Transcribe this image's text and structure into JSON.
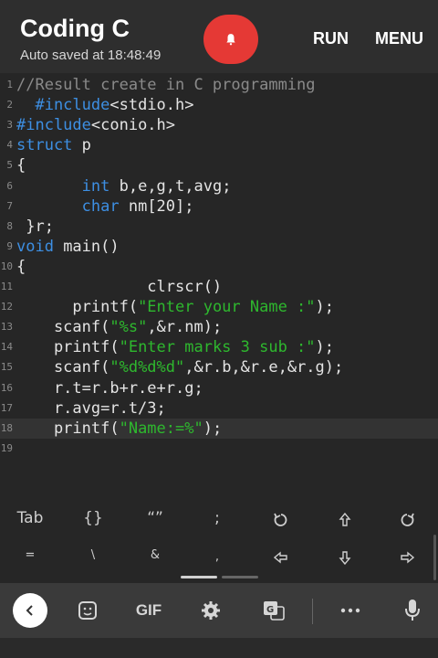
{
  "header": {
    "title": "Coding C",
    "subtitle": "Auto saved at 18:48:49",
    "run_label": "RUN",
    "menu_label": "MENU",
    "notification_icon": "bell-icon",
    "accent": "#e53935"
  },
  "editor": {
    "lines": [
      {
        "num": "1",
        "tokens": [
          {
            "t": "//Result create in C programming",
            "c": "comment"
          }
        ]
      },
      {
        "num": "2",
        "tokens": [
          {
            "t": "  #include",
            "c": "kw"
          },
          {
            "t": "<stdio.h>",
            "c": "plain"
          }
        ]
      },
      {
        "num": "3",
        "tokens": [
          {
            "t": "#include",
            "c": "kw"
          },
          {
            "t": "<conio.h>",
            "c": "plain"
          }
        ]
      },
      {
        "num": "4",
        "tokens": [
          {
            "t": "struct",
            "c": "kw"
          },
          {
            "t": " p",
            "c": "plain"
          }
        ]
      },
      {
        "num": "5",
        "tokens": [
          {
            "t": "{",
            "c": "plain"
          }
        ]
      },
      {
        "num": "6",
        "tokens": [
          {
            "t": "       ",
            "c": "plain"
          },
          {
            "t": "int",
            "c": "kw"
          },
          {
            "t": " b,e,g,t,avg;",
            "c": "plain"
          }
        ]
      },
      {
        "num": "7",
        "tokens": [
          {
            "t": "       ",
            "c": "plain"
          },
          {
            "t": "char",
            "c": "kw"
          },
          {
            "t": " nm[20];",
            "c": "plain"
          }
        ]
      },
      {
        "num": "8",
        "tokens": [
          {
            "t": " }r;",
            "c": "plain"
          }
        ]
      },
      {
        "num": "9",
        "tokens": [
          {
            "t": "void",
            "c": "kw"
          },
          {
            "t": " main()",
            "c": "plain"
          }
        ]
      },
      {
        "num": "10",
        "tokens": [
          {
            "t": "{",
            "c": "plain"
          }
        ]
      },
      {
        "num": "11",
        "tokens": [
          {
            "t": "              clrscr()",
            "c": "plain"
          }
        ]
      },
      {
        "num": "12",
        "tokens": [
          {
            "t": "      printf(",
            "c": "plain"
          },
          {
            "t": "\"Enter your Name :\"",
            "c": "str"
          },
          {
            "t": ");",
            "c": "plain"
          }
        ]
      },
      {
        "num": "13",
        "tokens": [
          {
            "t": "    scanf(",
            "c": "plain"
          },
          {
            "t": "\"%s\"",
            "c": "str"
          },
          {
            "t": ",&r.nm);",
            "c": "plain"
          }
        ]
      },
      {
        "num": "14",
        "tokens": [
          {
            "t": "    printf(",
            "c": "plain"
          },
          {
            "t": "\"Enter marks 3 sub :\"",
            "c": "str"
          },
          {
            "t": ");",
            "c": "plain"
          }
        ]
      },
      {
        "num": "15",
        "tokens": [
          {
            "t": "    scanf(",
            "c": "plain"
          },
          {
            "t": "\"%d%d%d\"",
            "c": "str"
          },
          {
            "t": ",&r.b,&r.e,&r.g);",
            "c": "plain"
          }
        ]
      },
      {
        "num": "16",
        "tokens": [
          {
            "t": "    r.t=r.b+r.e+r.g;",
            "c": "plain"
          }
        ]
      },
      {
        "num": "17",
        "tokens": [
          {
            "t": "    r.avg=r.t/3;",
            "c": "plain"
          }
        ]
      },
      {
        "num": "18",
        "tokens": [
          {
            "t": "    printf(",
            "c": "plain"
          },
          {
            "t": "\"Name:=%\"",
            "c": "str"
          },
          {
            "t": ");",
            "c": "plain"
          }
        ]
      },
      {
        "num": "19",
        "tokens": []
      }
    ],
    "current_line": 18
  },
  "keys": {
    "row1": [
      "Tab",
      "{}",
      "“”",
      ";",
      "undo-icon",
      "arrow-up-icon",
      "redo-icon"
    ],
    "row2": [
      "=",
      "\\",
      "&",
      ",",
      "arrow-left-icon",
      "arrow-down-icon",
      "arrow-right-icon"
    ]
  },
  "keyboard_toolbar": {
    "items": [
      "back-icon",
      "sticker-icon",
      "GIF",
      "settings-icon",
      "translate-icon",
      "more-icon",
      "mic-icon"
    ]
  }
}
